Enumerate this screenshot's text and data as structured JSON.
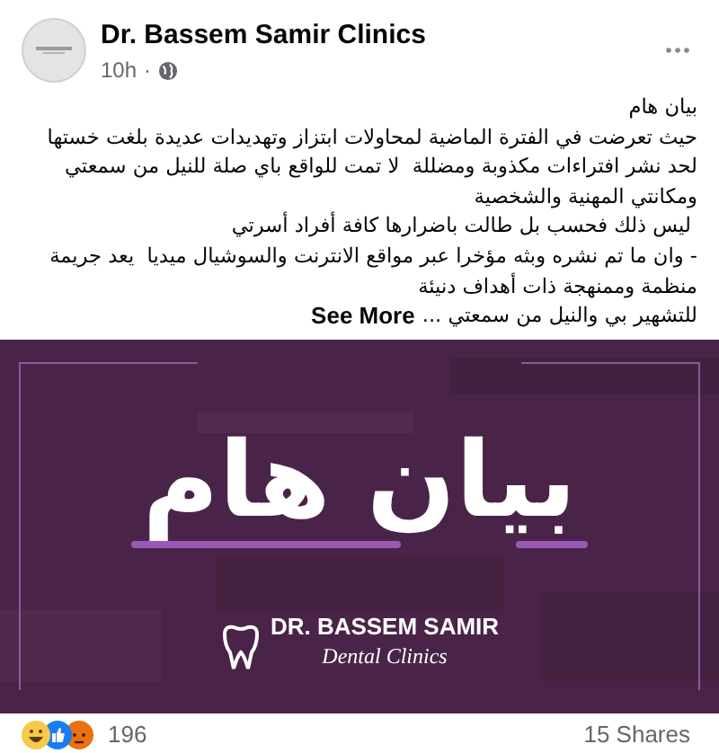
{
  "post": {
    "author": "Dr. Bassem Samir Clinics",
    "time": "10h",
    "separator": "·",
    "lines": [
      "بيان هام",
      "حيث تعرضت في الفترة الماضية لمحاولات ابتزاز وتهديدات عديدة بلغت خستها",
      "لحد نشر افتراءات مكذوبة ومضللة  لا تمت للواقع باي صلة للنيل من سمعتي",
      "ومكانتي المهنية والشخصية",
      " ليس ذلك فحسب بل طالت باضرارها كافة أفراد أسرتي",
      "- وان ما تم نشره وبثه مؤخرا عبر مواقع الانترنت والسوشيال ميديا  يعد جريمة",
      "منظمة وممنهجة ذات أهداف دنيئة"
    ],
    "last_line": "للتشهير بي والنيل من سمعتي ...",
    "see_more": "See More"
  },
  "graphic": {
    "headline": "بيان هام",
    "logo_name": "DR. BASSEM SAMIR",
    "logo_sub": "Dental Clinics"
  },
  "footer": {
    "reactions": [
      {
        "kind": "haha"
      },
      {
        "kind": "like"
      },
      {
        "kind": "angry"
      }
    ],
    "reaction_count": "196",
    "shares": "15 Shares"
  }
}
